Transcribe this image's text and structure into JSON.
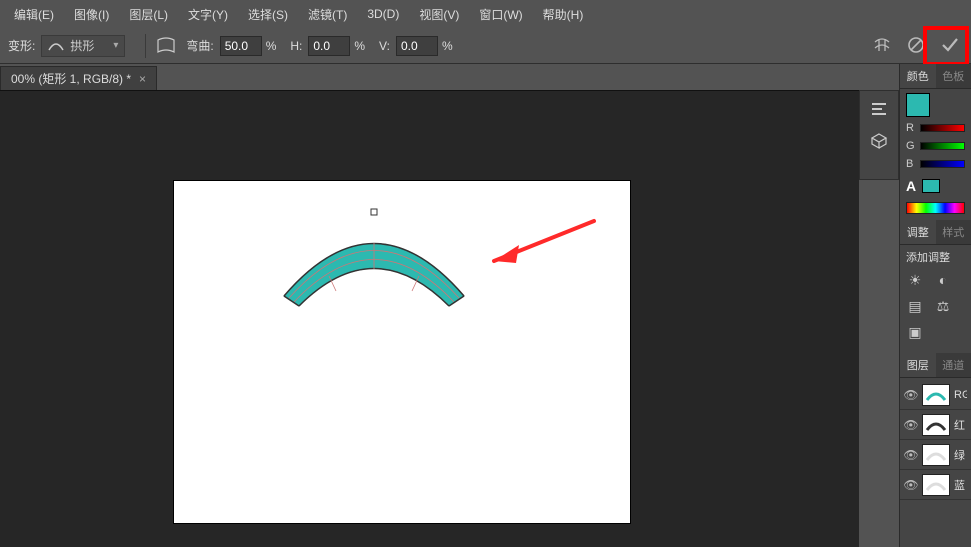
{
  "menu": {
    "edit": "编辑(E)",
    "image": "图像(I)",
    "layer": "图层(L)",
    "type": "文字(Y)",
    "select": "选择(S)",
    "filter": "滤镜(T)",
    "threeD": "3D(D)",
    "view": "视图(V)",
    "window": "窗口(W)",
    "help": "帮助(H)"
  },
  "options": {
    "deform_label": "变形:",
    "style": "拱形",
    "bend_label": "弯曲:",
    "bend_value": "50.0",
    "h_label": "H:",
    "h_value": "0.0",
    "v_label": "V:",
    "v_value": "0.0",
    "pct": "%"
  },
  "doc_tab": {
    "title": "00% (矩形 1, RGB/8) *",
    "close": "×"
  },
  "panels": {
    "color": {
      "tab_color": "颜色",
      "tab_swatch": "色板",
      "r": "R",
      "g": "G",
      "b": "B"
    },
    "char": {
      "A": "A"
    },
    "adjust": {
      "tab_adjust": "调整",
      "tab_style": "样式",
      "add_label": "添加调整"
    },
    "layers": {
      "tab_layers": "图层",
      "tab_channels": "通道",
      "items": [
        {
          "name": "RG"
        },
        {
          "name": "红"
        },
        {
          "name": "绿"
        },
        {
          "name": "蓝"
        }
      ]
    }
  }
}
